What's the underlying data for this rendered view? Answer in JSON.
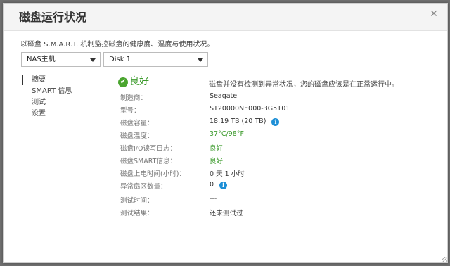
{
  "dialog": {
    "title": "磁盘运行状况",
    "close_icon": "close-icon",
    "description": "以磁盘 S.M.A.R.T. 机制监控磁盘的健康度、温度与使用状况。"
  },
  "selectors": {
    "device": "NAS主机",
    "disk": "Disk 1"
  },
  "nav": {
    "items": [
      {
        "label": "摘要",
        "active": true
      },
      {
        "label": "SMART 信息",
        "active": false
      },
      {
        "label": "测试",
        "active": false
      },
      {
        "label": "设置",
        "active": false
      }
    ]
  },
  "summary": {
    "status_icon": "check-circle-icon",
    "status": "良好",
    "status_message": "磁盘并没有检测到异常状况，您的磁盘应该是在正常运行中。",
    "rows": [
      {
        "label": "制造商：",
        "value": "Seagate"
      },
      {
        "label": "型号：",
        "value": "ST20000NE000-3G5101"
      },
      {
        "label": "磁盘容量：",
        "value": "18.19 TB (20 TB)",
        "info": true
      },
      {
        "label": "磁盘温度：",
        "value": "37°C/98°F",
        "green": true
      },
      {
        "label": "磁盘I/O读写日志：",
        "value": "良好",
        "green": true
      },
      {
        "label": "磁盘SMART信息：",
        "value": "良好",
        "green": true
      },
      {
        "label": "磁盘上电时间(小时)：",
        "value": "0 天 1 小时"
      },
      {
        "label": "异常扇区数量：",
        "value": "0",
        "info": true
      },
      {
        "label": "测试时间：",
        "value": "---"
      },
      {
        "label": "测试结果：",
        "value": "还未测试过"
      }
    ]
  },
  "colors": {
    "good": "#3d9b2d",
    "info": "#1e8fd6"
  }
}
